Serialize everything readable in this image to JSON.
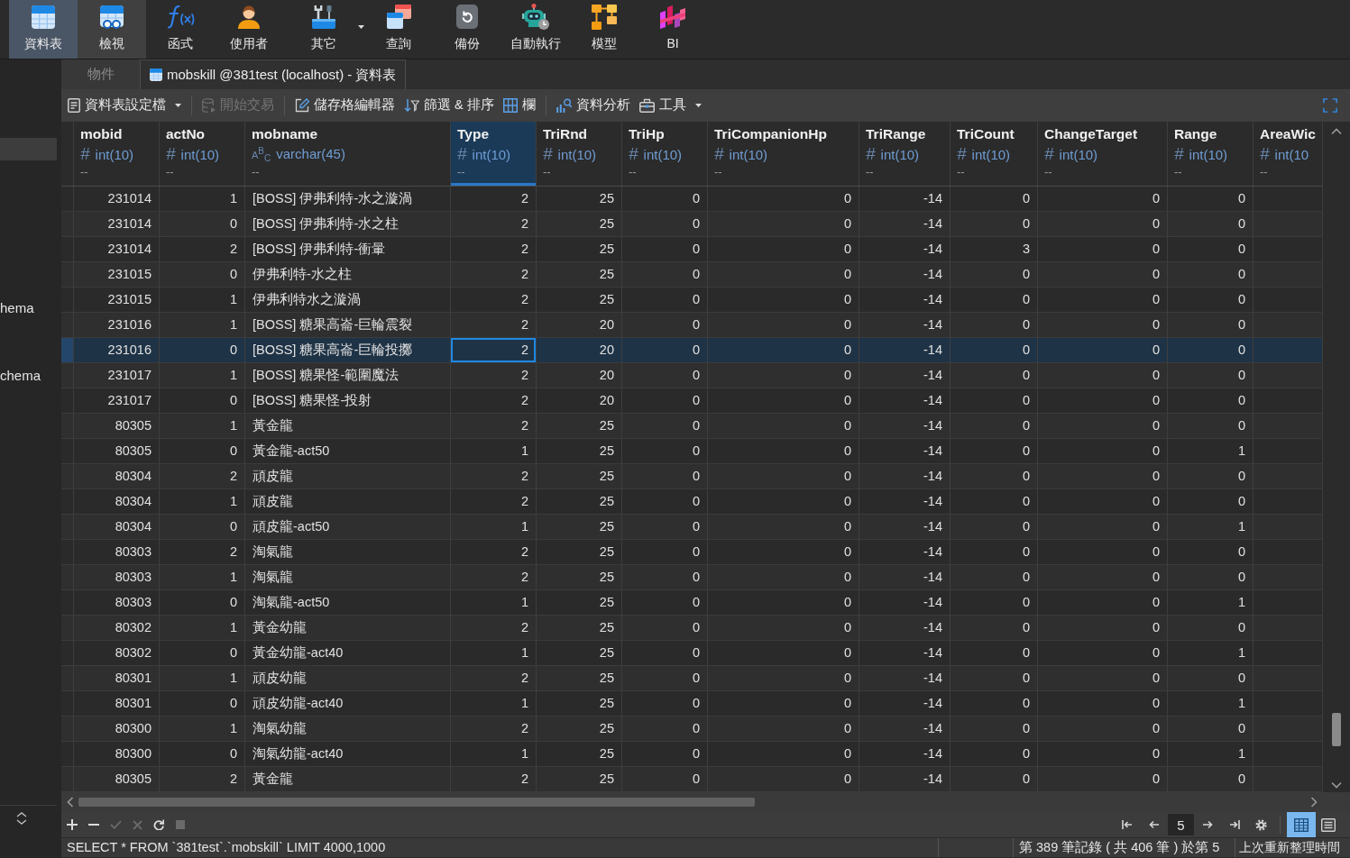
{
  "ribbon": {
    "items": [
      {
        "label": "資料表",
        "selected": true,
        "highlighted": false,
        "dropdown": false
      },
      {
        "label": "檢視",
        "selected": false,
        "highlighted": true,
        "dropdown": false
      },
      {
        "label": "函式",
        "selected": false,
        "highlighted": false,
        "dropdown": false
      },
      {
        "label": "使用者",
        "selected": false,
        "highlighted": false,
        "dropdown": false
      },
      {
        "label": "其它",
        "selected": false,
        "highlighted": false,
        "dropdown": true
      },
      {
        "label": "查詢",
        "selected": false,
        "highlighted": false,
        "dropdown": false
      },
      {
        "label": "備份",
        "selected": false,
        "highlighted": false,
        "dropdown": false
      },
      {
        "label": "自動執行",
        "selected": false,
        "highlighted": false,
        "dropdown": false
      },
      {
        "label": "模型",
        "selected": false,
        "highlighted": false,
        "dropdown": false
      },
      {
        "label": "BI",
        "selected": false,
        "highlighted": false,
        "dropdown": false
      }
    ]
  },
  "sidebar": {
    "items": [
      {
        "selected": true
      },
      {
        "label": "hema",
        "selected": false
      },
      {
        "label": "chema",
        "selected": false
      }
    ]
  },
  "tabs": [
    {
      "label": "物件",
      "selected": false
    },
    {
      "label": "mobskill @381test (localhost) - 資料表",
      "selected": true
    }
  ],
  "toolbar": {
    "groups": [
      {
        "buttons": [
          {
            "label": "資料表設定檔",
            "dropdown": true,
            "disabled": false
          }
        ]
      },
      {
        "buttons": [
          {
            "label": "開始交易",
            "dropdown": false,
            "disabled": true
          }
        ]
      },
      {
        "buttons": [
          {
            "label": "儲存格編輯器",
            "dropdown": false,
            "disabled": false
          },
          {
            "label": "篩選 & 排序",
            "dropdown": false,
            "disabled": false
          },
          {
            "label": "欄",
            "dropdown": false,
            "disabled": false
          }
        ]
      },
      {
        "buttons": [
          {
            "label": "資料分析",
            "dropdown": false,
            "disabled": false
          },
          {
            "label": "工具",
            "dropdown": true,
            "disabled": false
          }
        ]
      }
    ]
  },
  "table": {
    "columns": [
      {
        "name": "mobid",
        "kind": "number",
        "symbol": "#",
        "type": "int(10)",
        "default": "--",
        "selected": false
      },
      {
        "name": "actNo",
        "kind": "number",
        "symbol": "#",
        "type": "int(10)",
        "default": "--",
        "selected": false
      },
      {
        "name": "mobname",
        "kind": "text",
        "symbol": "A$^{B}$$_{C}$",
        "type": "varchar(45)",
        "default": "--",
        "selected": false
      },
      {
        "name": "Type",
        "kind": "number",
        "symbol": "#",
        "type": "int(10)",
        "default": "--",
        "selected": true
      },
      {
        "name": "TriRnd",
        "kind": "number",
        "symbol": "#",
        "type": "int(10)",
        "default": "--",
        "selected": false
      },
      {
        "name": "TriHp",
        "kind": "number",
        "symbol": "#",
        "type": "int(10)",
        "default": "--",
        "selected": false
      },
      {
        "name": "TriCompanionHp",
        "kind": "number",
        "symbol": "#",
        "type": "int(10)",
        "default": "--",
        "selected": false
      },
      {
        "name": "TriRange",
        "kind": "number",
        "symbol": "#",
        "type": "int(10)",
        "default": "--",
        "selected": false
      },
      {
        "name": "TriCount",
        "kind": "number",
        "symbol": "#",
        "type": "int(10)",
        "default": "--",
        "selected": false
      },
      {
        "name": "ChangeTarget",
        "kind": "number",
        "symbol": "#",
        "type": "int(10)",
        "default": "--",
        "selected": false
      },
      {
        "name": "Range",
        "kind": "number",
        "symbol": "#",
        "type": "int(10)",
        "default": "--",
        "selected": false
      },
      {
        "name": "AreaWic",
        "kind": "number",
        "symbol": "#",
        "type": "int(10",
        "default": "--",
        "selected": false
      }
    ],
    "rows": [
      {
        "cells": [
          "231014",
          "1",
          "[BOSS] 伊弗利特-水之漩渦",
          "2",
          "25",
          "0",
          "0",
          "-14",
          "0",
          "0",
          "0"
        ],
        "selected": false
      },
      {
        "cells": [
          "231014",
          "0",
          "[BOSS] 伊弗利特-水之柱",
          "2",
          "25",
          "0",
          "0",
          "-14",
          "0",
          "0",
          "0"
        ],
        "selected": false
      },
      {
        "cells": [
          "231014",
          "2",
          "[BOSS] 伊弗利特-衝暈",
          "2",
          "25",
          "0",
          "0",
          "-14",
          "3",
          "0",
          "0"
        ],
        "selected": false
      },
      {
        "cells": [
          "231015",
          "0",
          "伊弗利特-水之柱",
          "2",
          "25",
          "0",
          "0",
          "-14",
          "0",
          "0",
          "0"
        ],
        "selected": false
      },
      {
        "cells": [
          "231015",
          "1",
          "伊弗利特水之漩渦",
          "2",
          "25",
          "0",
          "0",
          "-14",
          "0",
          "0",
          "0"
        ],
        "selected": false
      },
      {
        "cells": [
          "231016",
          "1",
          "[BOSS] 糖果高崙-巨輪震裂",
          "2",
          "20",
          "0",
          "0",
          "-14",
          "0",
          "0",
          "0"
        ],
        "selected": false
      },
      {
        "cells": [
          "231016",
          "0",
          "[BOSS] 糖果高崙-巨輪投擲",
          "2",
          "20",
          "0",
          "0",
          "-14",
          "0",
          "0",
          "0"
        ],
        "selected": true
      },
      {
        "cells": [
          "231017",
          "1",
          "[BOSS] 糖果怪-範圍魔法",
          "2",
          "20",
          "0",
          "0",
          "-14",
          "0",
          "0",
          "0"
        ],
        "selected": false
      },
      {
        "cells": [
          "231017",
          "0",
          "[BOSS] 糖果怪-投射",
          "2",
          "20",
          "0",
          "0",
          "-14",
          "0",
          "0",
          "0"
        ],
        "selected": false
      },
      {
        "cells": [
          "80305",
          "1",
          "黃金龍",
          "2",
          "25",
          "0",
          "0",
          "-14",
          "0",
          "0",
          "0"
        ],
        "selected": false
      },
      {
        "cells": [
          "80305",
          "0",
          "黃金龍-act50",
          "1",
          "25",
          "0",
          "0",
          "-14",
          "0",
          "0",
          "1"
        ],
        "selected": false
      },
      {
        "cells": [
          "80304",
          "2",
          "頑皮龍",
          "2",
          "25",
          "0",
          "0",
          "-14",
          "0",
          "0",
          "0"
        ],
        "selected": false
      },
      {
        "cells": [
          "80304",
          "1",
          "頑皮龍",
          "2",
          "25",
          "0",
          "0",
          "-14",
          "0",
          "0",
          "0"
        ],
        "selected": false
      },
      {
        "cells": [
          "80304",
          "0",
          "頑皮龍-act50",
          "1",
          "25",
          "0",
          "0",
          "-14",
          "0",
          "0",
          "1"
        ],
        "selected": false
      },
      {
        "cells": [
          "80303",
          "2",
          "淘氣龍",
          "2",
          "25",
          "0",
          "0",
          "-14",
          "0",
          "0",
          "0"
        ],
        "selected": false
      },
      {
        "cells": [
          "80303",
          "1",
          "淘氣龍",
          "2",
          "25",
          "0",
          "0",
          "-14",
          "0",
          "0",
          "0"
        ],
        "selected": false
      },
      {
        "cells": [
          "80303",
          "0",
          "淘氣龍-act50",
          "1",
          "25",
          "0",
          "0",
          "-14",
          "0",
          "0",
          "1"
        ],
        "selected": false
      },
      {
        "cells": [
          "80302",
          "1",
          "黃金幼龍",
          "2",
          "25",
          "0",
          "0",
          "-14",
          "0",
          "0",
          "0"
        ],
        "selected": false
      },
      {
        "cells": [
          "80302",
          "0",
          "黃金幼龍-act40",
          "1",
          "25",
          "0",
          "0",
          "-14",
          "0",
          "0",
          "1"
        ],
        "selected": false
      },
      {
        "cells": [
          "80301",
          "1",
          "頑皮幼龍",
          "2",
          "25",
          "0",
          "0",
          "-14",
          "0",
          "0",
          "0"
        ],
        "selected": false
      },
      {
        "cells": [
          "80301",
          "0",
          "頑皮幼龍-act40",
          "1",
          "25",
          "0",
          "0",
          "-14",
          "0",
          "0",
          "1"
        ],
        "selected": false
      },
      {
        "cells": [
          "80300",
          "1",
          "淘氣幼龍",
          "2",
          "25",
          "0",
          "0",
          "-14",
          "0",
          "0",
          "0"
        ],
        "selected": false
      },
      {
        "cells": [
          "80300",
          "0",
          "淘氣幼龍-act40",
          "1",
          "25",
          "0",
          "0",
          "-14",
          "0",
          "0",
          "1"
        ],
        "selected": false
      },
      {
        "cells": [
          "80305",
          "2",
          "黃金龍",
          "2",
          "25",
          "0",
          "0",
          "-14",
          "0",
          "0",
          "0"
        ],
        "selected": false
      }
    ]
  },
  "record_buttons": [
    {
      "disabled": false
    },
    {
      "disabled": false
    },
    {
      "disabled": true
    },
    {
      "disabled": true
    },
    {
      "disabled": false
    },
    {
      "disabled": true
    }
  ],
  "pager": {
    "page": "5"
  },
  "view_modes": [
    {
      "selected": true
    },
    {
      "selected": false
    }
  ],
  "status_bar": {
    "query": "SELECT * FROM `381test`.`mobskill` LIMIT 4000,1000",
    "record_info": "第 389 筆記錄 ( 共 406 筆 ) 於第 5",
    "refresh_info": "上次重新整理時間"
  }
}
